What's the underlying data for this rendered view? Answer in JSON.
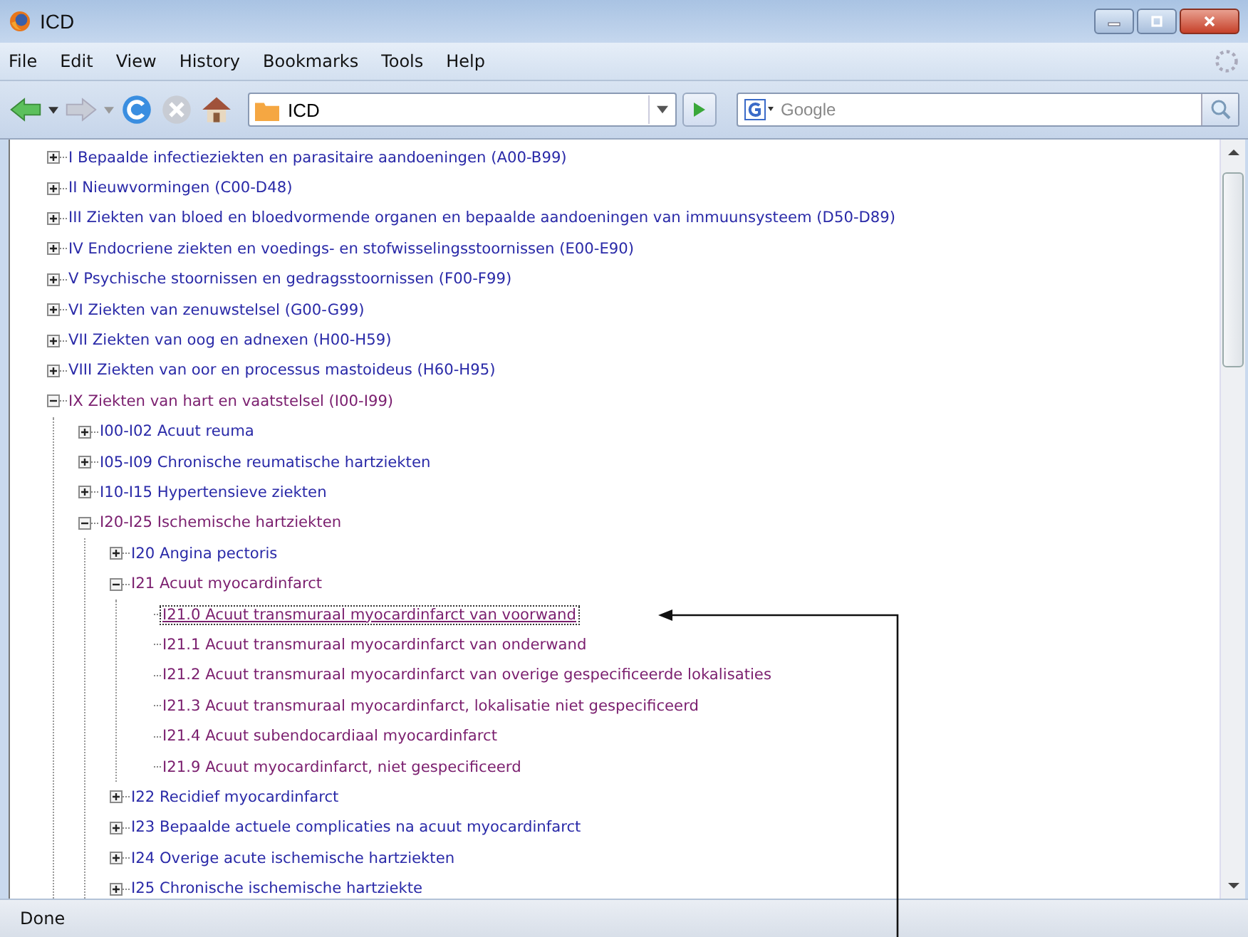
{
  "window": {
    "title": "ICD"
  },
  "menu": [
    "File",
    "Edit",
    "View",
    "History",
    "Bookmarks",
    "Tools",
    "Help"
  ],
  "address": {
    "value": "ICD"
  },
  "search": {
    "placeholder": "Google"
  },
  "tree": [
    {
      "label": "I Bepaalde infectieziekten en parasitaire aandoeningen (A00-B99)",
      "expanded": false,
      "visited": false,
      "selected": false
    },
    {
      "label": "II Nieuwvormingen (C00-D48)",
      "expanded": false,
      "visited": false,
      "selected": false
    },
    {
      "label": "III Ziekten van bloed en bloedvormende organen en bepaalde aandoeningen van immuunsysteem (D50-D89)",
      "expanded": false,
      "visited": false,
      "selected": false
    },
    {
      "label": "IV Endocriene ziekten en voedings- en stofwisselingsstoornissen (E00-E90)",
      "expanded": false,
      "visited": false,
      "selected": false
    },
    {
      "label": "V Psychische stoornissen en gedragsstoornissen (F00-F99)",
      "expanded": false,
      "visited": false,
      "selected": false
    },
    {
      "label": "VI Ziekten van zenuwstelsel (G00-G99)",
      "expanded": false,
      "visited": false,
      "selected": false
    },
    {
      "label": "VII Ziekten van oog en adnexen (H00-H59)",
      "expanded": false,
      "visited": false,
      "selected": false
    },
    {
      "label": "VIII Ziekten van oor en processus mastoideus (H60-H95)",
      "expanded": false,
      "visited": false,
      "selected": false
    },
    {
      "label": "IX Ziekten van hart en vaatstelsel (I00-I99)",
      "expanded": true,
      "visited": true,
      "selected": false,
      "children": [
        {
          "label": "I00-I02 Acuut reuma",
          "expanded": false,
          "visited": false,
          "selected": false
        },
        {
          "label": "I05-I09 Chronische reumatische hartziekten",
          "expanded": false,
          "visited": false,
          "selected": false
        },
        {
          "label": "I10-I15 Hypertensieve ziekten",
          "expanded": false,
          "visited": false,
          "selected": false
        },
        {
          "label": "I20-I25 Ischemische hartziekten",
          "expanded": true,
          "visited": true,
          "selected": false,
          "children": [
            {
              "label": "I20 Angina pectoris",
              "expanded": false,
              "visited": false,
              "selected": false
            },
            {
              "label": "I21 Acuut myocardinfarct",
              "expanded": true,
              "visited": true,
              "selected": false,
              "children": [
                {
                  "label": "I21.0 Acuut transmuraal myocardinfarct van voorwand",
                  "visited": true,
                  "selected": true
                },
                {
                  "label": "I21.1 Acuut transmuraal myocardinfarct van onderwand",
                  "visited": true,
                  "selected": false
                },
                {
                  "label": "I21.2 Acuut transmuraal myocardinfarct van overige gespecificeerde lokalisaties",
                  "visited": true,
                  "selected": false
                },
                {
                  "label": "I21.3 Acuut transmuraal myocardinfarct, lokalisatie niet gespecificeerd",
                  "visited": true,
                  "selected": false
                },
                {
                  "label": "I21.4 Acuut subendocardiaal myocardinfarct",
                  "visited": true,
                  "selected": false
                },
                {
                  "label": "I21.9 Acuut myocardinfarct, niet gespecificeerd",
                  "visited": true,
                  "selected": false
                }
              ]
            },
            {
              "label": "I22 Recidief myocardinfarct",
              "expanded": false,
              "visited": false,
              "selected": false
            },
            {
              "label": "I23 Bepaalde actuele complicaties na acuut myocardinfarct",
              "expanded": false,
              "visited": false,
              "selected": false
            },
            {
              "label": "I24 Overige acute ischemische hartziekten",
              "expanded": false,
              "visited": false,
              "selected": false
            },
            {
              "label": "I25 Chronische ischemische hartziekte",
              "expanded": false,
              "visited": false,
              "selected": false
            }
          ]
        }
      ]
    }
  ],
  "status_bar": {
    "text": "Done"
  }
}
